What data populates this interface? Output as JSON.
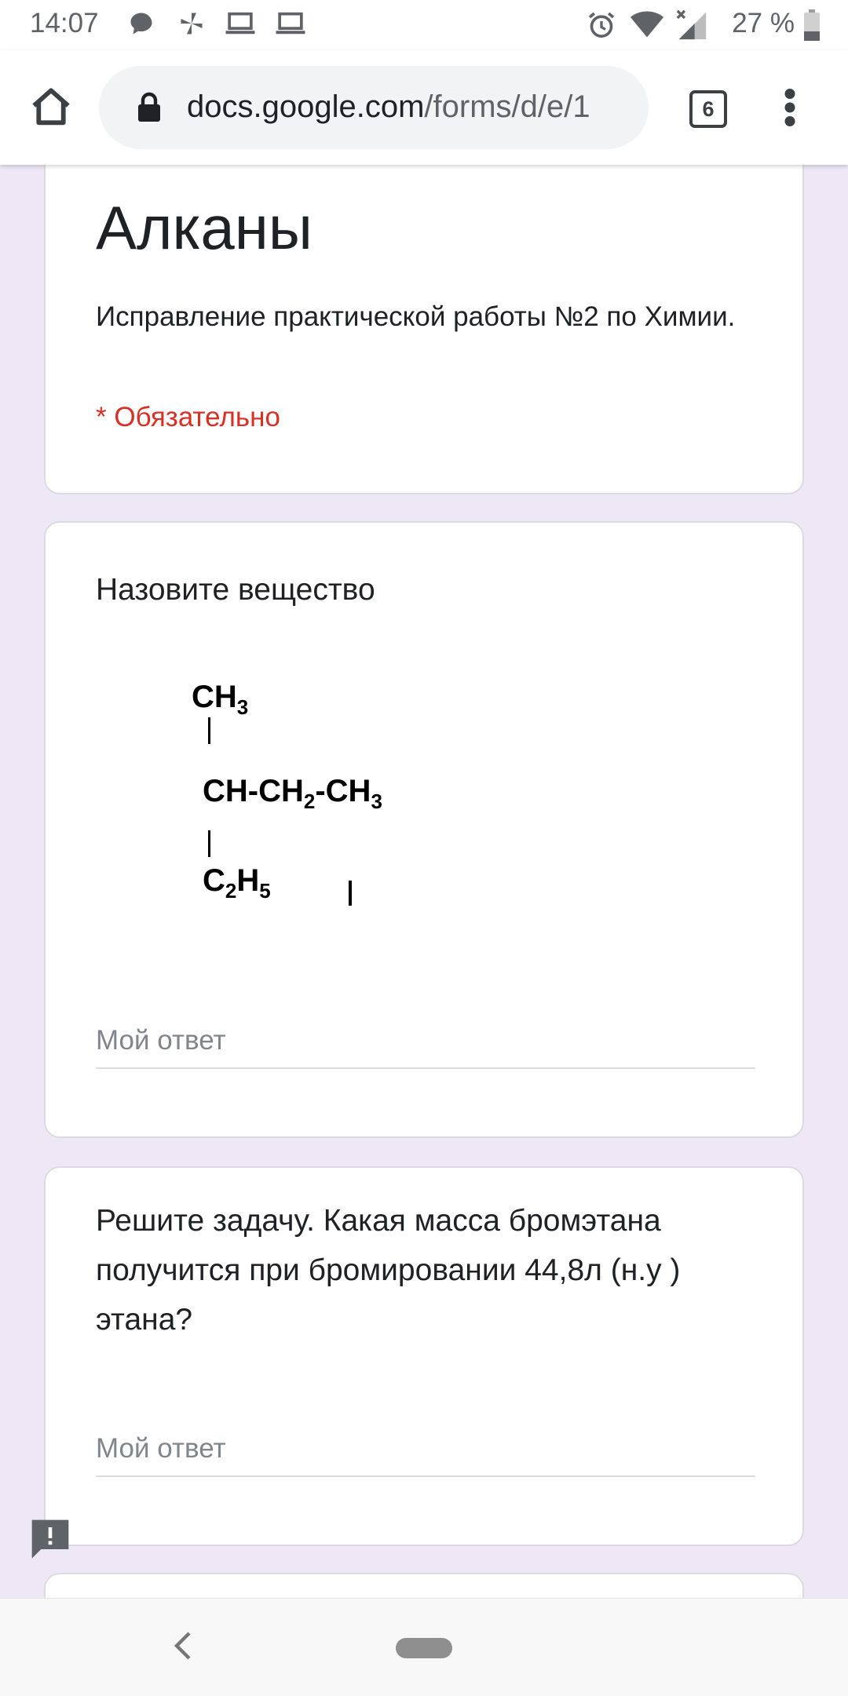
{
  "status_bar": {
    "time": "14:07",
    "battery": "27 %",
    "icons": [
      "chat-bubble-icon",
      "pinwheel-icon",
      "laptop-icon",
      "laptop-icon",
      "alarm-icon",
      "wifi-icon",
      "signal-icon",
      "battery-icon"
    ]
  },
  "browser": {
    "url_host": "docs.google.com",
    "url_path": "/forms/d/e/1",
    "tab_count": "6",
    "icons": [
      "home-icon",
      "lock-icon",
      "tab-switcher-icon",
      "more-vert-icon"
    ]
  },
  "form": {
    "title": "Алканы",
    "description": "Исправление практической работы №2 по Химии.",
    "required_note": "* Обязательно"
  },
  "questions": [
    {
      "title": "Назовите вещество",
      "formula": {
        "top": "CH",
        "top_sub": "3",
        "main_a": "CH-CH",
        "main_sub1": "2",
        "main_b": "-CH",
        "main_sub2": "3",
        "bottom_a": "C",
        "bottom_sub1": "2",
        "bottom_b": "H",
        "bottom_sub2": "5"
      },
      "answer_placeholder": "Мой ответ"
    },
    {
      "title": "Решите задачу. Какая масса бромэтана получится при бромировании 44,8л (н.у ) этана?",
      "answer_placeholder": "Мой ответ"
    }
  ],
  "feedback": {
    "icon": "feedback-icon"
  },
  "nav": {
    "icons": [
      "back-icon",
      "home-pill-icon"
    ]
  },
  "colors": {
    "background": "#ede7f6",
    "required": "#d93025",
    "accent": "#673ab7"
  }
}
